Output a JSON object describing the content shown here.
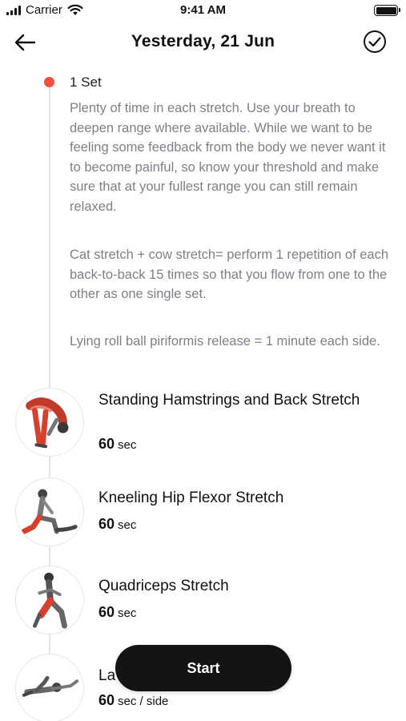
{
  "status_bar": {
    "carrier": "Carrier",
    "time": "9:41 AM"
  },
  "nav": {
    "title": "Yesterday, 21 Jun"
  },
  "set": {
    "label": "1 Set",
    "description_1": "Plenty of time in each stretch. Use your breath to deepen range where available. While we want to be feeling some feedback from the body we never want it to become painful, so know your threshold and make sure that at your fullest range you can still remain relaxed.",
    "description_2": "Cat stretch + cow stretch= perform 1 repetition of each back-to-back 15 times so that you flow from one to the other as one single set.",
    "description_3": "Lying roll ball piriformis release = 1 minute each side."
  },
  "exercises": [
    {
      "name": "Standing Hamstrings and Back Stretch",
      "duration": "60",
      "unit": "sec"
    },
    {
      "name": "Kneeling Hip Flexor Stretch",
      "duration": "60",
      "unit": "sec"
    },
    {
      "name": "Quadriceps Stretch",
      "duration": "60",
      "unit": "sec"
    },
    {
      "name": "La",
      "duration": "60",
      "unit": "sec / side"
    }
  ],
  "start_button": {
    "label": "Start"
  },
  "colors": {
    "accent_dot": "#f0503c",
    "muscle_highlight": "#d8402e",
    "button_bg": "#141414"
  }
}
